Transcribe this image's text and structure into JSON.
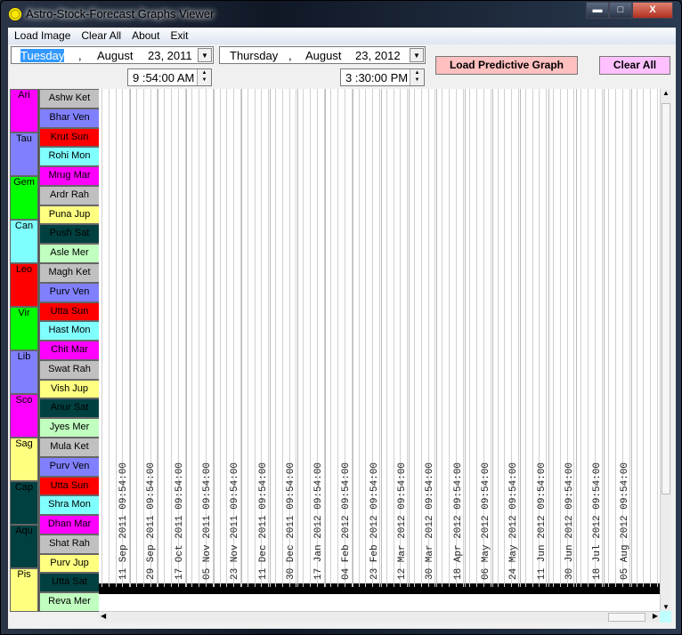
{
  "window": {
    "title": "Astro-Stock-Forecast Graphs Viewer",
    "minimize": "▬",
    "maximize": "□",
    "close": "X"
  },
  "menu": [
    "Load Image",
    "Clear All",
    "About",
    "Exit"
  ],
  "start": {
    "weekday": "Tuesday",
    "month": "August",
    "day_year": "23, 2011",
    "time": "9 :54:00 AM"
  },
  "end": {
    "weekday": "Thursday",
    "month": "August",
    "day_year": "23, 2012",
    "time": "3 :30:00 PM"
  },
  "buttons": {
    "load_graph": "Load Predictive Graph",
    "clear_all": "Clear All",
    "load_color": "#ffc0c0",
    "clear_color": "#ffc0ff"
  },
  "signs": [
    {
      "label": "Ari",
      "color": "#ff00ff",
      "text": "#000"
    },
    {
      "label": "Tau",
      "color": "#8080ff",
      "text": "#000"
    },
    {
      "label": "Gem",
      "color": "#00ff00",
      "text": "#000"
    },
    {
      "label": "Can",
      "color": "#80ffff",
      "text": "#000"
    },
    {
      "label": "Leo",
      "color": "#ff0000",
      "text": "#000"
    },
    {
      "label": "Vir",
      "color": "#00ff00",
      "text": "#000"
    },
    {
      "label": "Lib",
      "color": "#8080ff",
      "text": "#000"
    },
    {
      "label": "Sco",
      "color": "#ff00ff",
      "text": "#000"
    },
    {
      "label": "Sag",
      "color": "#ffff80",
      "text": "#000"
    },
    {
      "label": "Cap",
      "color": "#004040",
      "text": "#000"
    },
    {
      "label": "Aqu",
      "color": "#004040",
      "text": "#000"
    },
    {
      "label": "Pis",
      "color": "#ffff80",
      "text": "#000"
    }
  ],
  "nakshatras": [
    {
      "label": "Ashw Ket",
      "color": "#c0c0c0"
    },
    {
      "label": "Bhar Ven",
      "color": "#8080ff"
    },
    {
      "label": "Krut Sun",
      "color": "#ff0000"
    },
    {
      "label": "Rohi Mon",
      "color": "#80ffff"
    },
    {
      "label": "Mrug Mar",
      "color": "#ff00ff"
    },
    {
      "label": "Ardr Rah",
      "color": "#c0c0c0"
    },
    {
      "label": "Puna Jup",
      "color": "#ffff80"
    },
    {
      "label": "Push Sat",
      "color": "#004040"
    },
    {
      "label": "Asle Mer",
      "color": "#c0ffc0"
    },
    {
      "label": "Magh Ket",
      "color": "#c0c0c0"
    },
    {
      "label": "Purv Ven",
      "color": "#8080ff"
    },
    {
      "label": "Utta Sun",
      "color": "#ff0000"
    },
    {
      "label": "Hast Mon",
      "color": "#80ffff"
    },
    {
      "label": "Chit Mar",
      "color": "#ff00ff"
    },
    {
      "label": "Swat Rah",
      "color": "#c0c0c0"
    },
    {
      "label": "Vish Jup",
      "color": "#ffff80"
    },
    {
      "label": "Anur Sat",
      "color": "#004040"
    },
    {
      "label": "Jyes Mer",
      "color": "#c0ffc0"
    },
    {
      "label": "Mula Ket",
      "color": "#c0c0c0"
    },
    {
      "label": "Purv Ven",
      "color": "#8080ff"
    },
    {
      "label": "Utta Sun",
      "color": "#ff0000"
    },
    {
      "label": "Shra Mon",
      "color": "#80ffff"
    },
    {
      "label": "Dhan Mar",
      "color": "#ff00ff"
    },
    {
      "label": "Shat Rah",
      "color": "#c0c0c0"
    },
    {
      "label": "Purv Jup",
      "color": "#ffff80"
    },
    {
      "label": "Utta Sat",
      "color": "#004040"
    },
    {
      "label": "Reva Mer",
      "color": "#c0ffc0"
    }
  ],
  "date_labels": [
    "11 Sep 2011 09:54:00",
    "29 Sep 2011 09:54:00",
    "17 Oct 2011 09:54:00",
    "05 Nov 2011 09:54:00",
    "23 Nov 2011 09:54:00",
    "11 Dec 2011 09:54:00",
    "30 Dec 2011 09:54:00",
    "17 Jan 2012 09:54:00",
    "04 Feb 2012 09:54:00",
    "23 Feb 2012 09:54:00",
    "12 Mar 2012 09:54:00",
    "30 Mar 2012 09:54:00",
    "18 Apr 2012 09:54:00",
    "06 May 2012 09:54:00",
    "24 May 2012 09:54:00",
    "11 Jun 2012 09:54:00",
    "30 Jun 2012 09:54:00",
    "18 Jul 2012 09:54:00",
    "05 Aug 2012 09:54:00"
  ]
}
